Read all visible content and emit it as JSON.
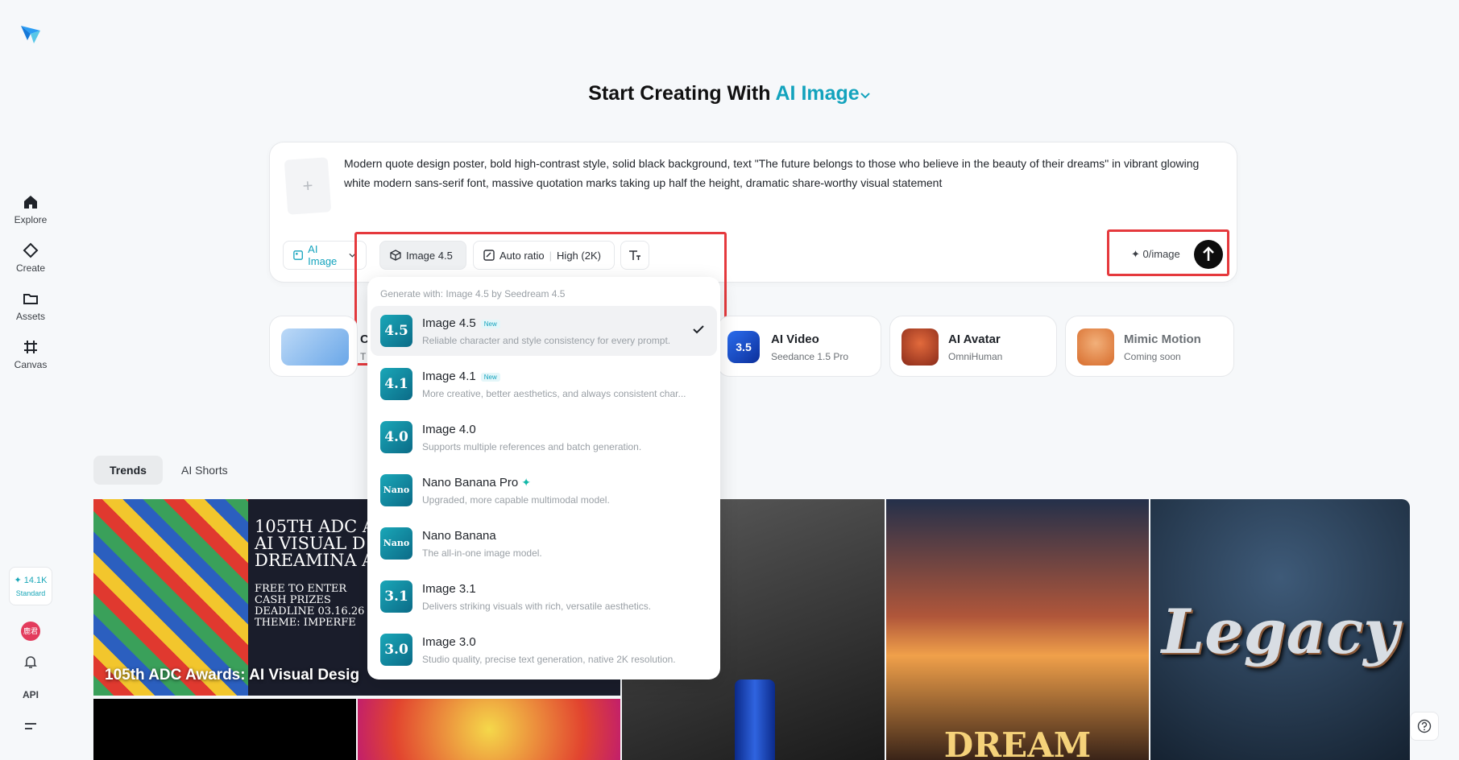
{
  "sidebar": {
    "items": [
      {
        "label": "Explore",
        "icon": "home-icon"
      },
      {
        "label": "Create",
        "icon": "diamond-icon"
      },
      {
        "label": "Assets",
        "icon": "folder-icon"
      },
      {
        "label": "Canvas",
        "icon": "hash-icon"
      }
    ],
    "credits": "14.1K",
    "plan": "Standard",
    "avatar_text": "鹿君",
    "api_label": "API"
  },
  "header": {
    "prefix": "Start Creating With",
    "mode": "AI Image"
  },
  "prompt": {
    "text": "Modern quote design poster, bold high-contrast style, solid black background, text \"The future belongs to those who believe in the beauty of their dreams\" in vibrant glowing white modern sans-serif font, massive quotation marks taking up half the height, dramatic share-worthy visual statement",
    "upload_symbol": "+",
    "toolbar": {
      "mode_label": "AI Image",
      "model_label": "Image 4.5",
      "ratio_label": "Auto ratio",
      "quality_label": "High (2K)",
      "cost_label": "0/image"
    }
  },
  "features": [
    {
      "title": "C",
      "subtitle": "T"
    },
    {
      "title": "AI Video",
      "subtitle": "Seedance 1.5 Pro",
      "thumb_text": "3.5"
    },
    {
      "title": "AI Avatar",
      "subtitle": "OmniHuman"
    },
    {
      "title": "Mimic Motion",
      "subtitle": "Coming soon"
    }
  ],
  "tabs": [
    "Trends",
    "AI Shorts"
  ],
  "gallery": {
    "caption": "105th ADC Awards: AI Visual Desig",
    "poster_text": [
      "105TH ADC A",
      "AI VISUAL D",
      "DREAMINA A",
      "FREE TO ENTER",
      "CASH PRIZES",
      "DEADLINE 03.16.26",
      "THEME: IMPERFE"
    ],
    "legacy_text": "Legacy",
    "dream_text": "DREAM"
  },
  "dropdown": {
    "header": "Generate with: Image 4.5 by Seedream 4.5",
    "items": [
      {
        "title": "Image 4.5",
        "badge": "New",
        "desc": "Reliable character and style consistency for every prompt.",
        "thumb": "4.5",
        "selected": true
      },
      {
        "title": "Image 4.1",
        "badge": "New",
        "desc": "More creative, better aesthetics, and always consistent char...",
        "thumb": "4.1"
      },
      {
        "title": "Image 4.0",
        "desc": "Supports multiple references and batch generation.",
        "thumb": "4.0"
      },
      {
        "title": "Nano Banana Pro",
        "spark": "✦",
        "desc": "Upgraded, more capable multimodal model.",
        "thumb": "Nano"
      },
      {
        "title": "Nano Banana",
        "desc": "The all-in-one image model.",
        "thumb": "Nano"
      },
      {
        "title": "Image 3.1",
        "desc": "Delivers striking visuals with rich, versatile aesthetics.",
        "thumb": "3.1"
      },
      {
        "title": "Image 3.0",
        "desc": "Studio quality, precise text generation, native 2K resolution.",
        "thumb": "3.0"
      }
    ]
  },
  "colors": {
    "accent": "#13a3bd",
    "highlight": "#e5393d"
  }
}
